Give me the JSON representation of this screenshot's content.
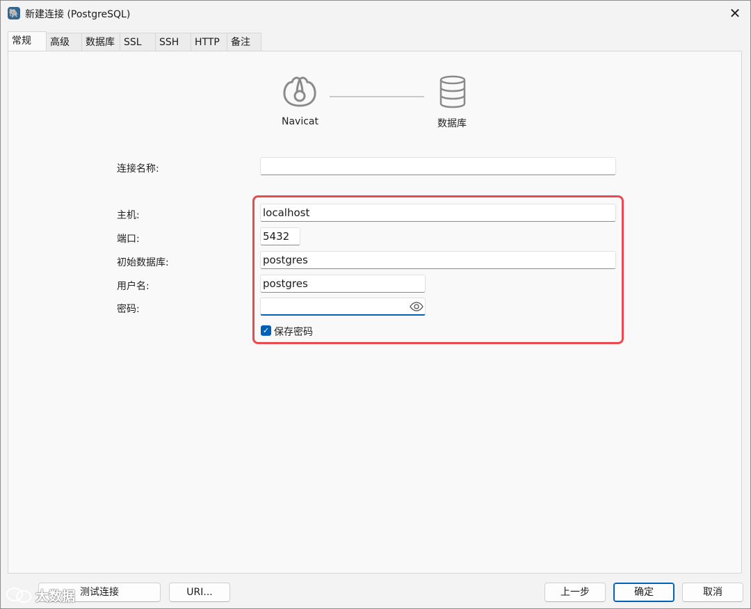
{
  "window": {
    "title": "新建连接 (PostgreSQL)",
    "close": "✕"
  },
  "tabs": [
    {
      "label": "常规",
      "active": true
    },
    {
      "label": "高级"
    },
    {
      "label": "数据库"
    },
    {
      "label": "SSL"
    },
    {
      "label": "SSH"
    },
    {
      "label": "HTTP"
    },
    {
      "label": "备注"
    }
  ],
  "steps": [
    {
      "label": "Navicat",
      "icon": "navicat-logo-icon"
    },
    {
      "label": "数据库",
      "icon": "database-icon"
    }
  ],
  "form": {
    "connection_name": {
      "label": "连接名称:",
      "value": ""
    },
    "host": {
      "label": "主机:",
      "value": "localhost"
    },
    "port": {
      "label": "端口:",
      "value": "5432"
    },
    "initial_db": {
      "label": "初始数据库:",
      "value": "postgres"
    },
    "username": {
      "label": "用户名:",
      "value": "postgres"
    },
    "password": {
      "label": "密码:",
      "value": ""
    },
    "save_password": {
      "label": "保存密码",
      "checked": true
    }
  },
  "buttons": {
    "test": "测试连接",
    "uri": "URI...",
    "back": "上一步",
    "ok": "确定",
    "cancel": "取消"
  },
  "watermark": "大数据",
  "colors": {
    "accent": "#005fb8",
    "highlight": "#e84a4f"
  }
}
